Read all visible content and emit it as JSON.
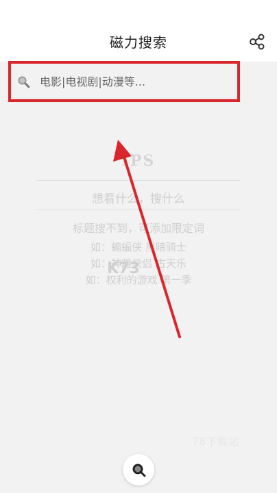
{
  "header": {
    "title": "磁力搜索",
    "share_icon": "share-icon"
  },
  "search": {
    "placeholder": "电影|电视剧|动漫等...",
    "icon": "search-icon"
  },
  "empty_state": {
    "logo": "IPS",
    "slogan": "想看什么，搜什么",
    "hint": "标题搜不到，可添加限定词",
    "examples": [
      "如：蝙蝠侠 黑暗骑士",
      "如：神雕侠侣 古天乐",
      "如：权利的游戏 第一季"
    ]
  },
  "watermarks": {
    "k73": "K73",
    "site": "78下载站"
  },
  "fab": {
    "icon": "search-icon"
  },
  "colors": {
    "annotation_red": "#d9262c",
    "background": "#f2f2f2",
    "faded_text": "#cfcfcf"
  }
}
